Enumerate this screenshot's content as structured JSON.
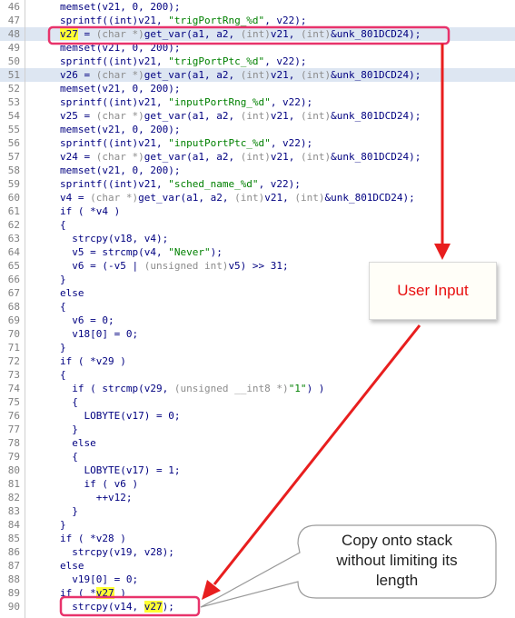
{
  "code_lines": [
    {
      "ln": "46",
      "parts": [
        {
          "t": "memset(v21, 0, 200);"
        }
      ]
    },
    {
      "ln": "47",
      "parts": [
        {
          "t": "sprintf((int)v21, "
        },
        {
          "t": "\"trigPortRng_%d\"",
          "c": "str"
        },
        {
          "t": ", v22);"
        }
      ]
    },
    {
      "ln": "48",
      "highlight": true,
      "parts": [
        {
          "t": "v27",
          "c": "yellow"
        },
        {
          "t": " = "
        },
        {
          "t": "(char *)",
          "c": "fade"
        },
        {
          "t": "get_var(a1, a2, "
        },
        {
          "t": "(int)",
          "c": "fade"
        },
        {
          "t": "v21, "
        },
        {
          "t": "(int)",
          "c": "fade"
        },
        {
          "t": "&unk_801DCD24);"
        }
      ]
    },
    {
      "ln": "49",
      "parts": [
        {
          "t": "memset(v21, 0, 200);"
        }
      ]
    },
    {
      "ln": "50",
      "parts": [
        {
          "t": "sprintf((int)v21, "
        },
        {
          "t": "\"trigPortPtc_%d\"",
          "c": "str"
        },
        {
          "t": ", v22);"
        }
      ]
    },
    {
      "ln": "51",
      "highlight": true,
      "parts": [
        {
          "t": "v26 = "
        },
        {
          "t": "(char *)",
          "c": "fade"
        },
        {
          "t": "get_var(a1, a2, "
        },
        {
          "t": "(int)",
          "c": "fade"
        },
        {
          "t": "v21, "
        },
        {
          "t": "(int)",
          "c": "fade"
        },
        {
          "t": "&unk_801DCD24);"
        }
      ]
    },
    {
      "ln": "52",
      "parts": [
        {
          "t": "memset(v21, 0, 200);"
        }
      ]
    },
    {
      "ln": "53",
      "parts": [
        {
          "t": "sprintf((int)v21, "
        },
        {
          "t": "\"inputPortRng_%d\"",
          "c": "str"
        },
        {
          "t": ", v22);"
        }
      ]
    },
    {
      "ln": "54",
      "parts": [
        {
          "t": "v25 = "
        },
        {
          "t": "(char *)",
          "c": "fade"
        },
        {
          "t": "get_var(a1, a2, "
        },
        {
          "t": "(int)",
          "c": "fade"
        },
        {
          "t": "v21, "
        },
        {
          "t": "(int)",
          "c": "fade"
        },
        {
          "t": "&unk_801DCD24);"
        }
      ]
    },
    {
      "ln": "55",
      "parts": [
        {
          "t": "memset(v21, 0, 200);"
        }
      ]
    },
    {
      "ln": "56",
      "parts": [
        {
          "t": "sprintf((int)v21, "
        },
        {
          "t": "\"inputPortPtc_%d\"",
          "c": "str"
        },
        {
          "t": ", v22);"
        }
      ]
    },
    {
      "ln": "57",
      "parts": [
        {
          "t": "v24 = "
        },
        {
          "t": "(char *)",
          "c": "fade"
        },
        {
          "t": "get_var(a1, a2, "
        },
        {
          "t": "(int)",
          "c": "fade"
        },
        {
          "t": "v21, "
        },
        {
          "t": "(int)",
          "c": "fade"
        },
        {
          "t": "&unk_801DCD24);"
        }
      ]
    },
    {
      "ln": "58",
      "parts": [
        {
          "t": "memset(v21, 0, 200);"
        }
      ]
    },
    {
      "ln": "59",
      "parts": [
        {
          "t": "sprintf((int)v21, "
        },
        {
          "t": "\"sched_name_%d\"",
          "c": "str"
        },
        {
          "t": ", v22);"
        }
      ]
    },
    {
      "ln": "60",
      "parts": [
        {
          "t": "v4 = "
        },
        {
          "t": "(char *)",
          "c": "fade"
        },
        {
          "t": "get_var(a1, a2, "
        },
        {
          "t": "(int)",
          "c": "fade"
        },
        {
          "t": "v21, "
        },
        {
          "t": "(int)",
          "c": "fade"
        },
        {
          "t": "&unk_801DCD24);"
        }
      ]
    },
    {
      "ln": "61",
      "parts": [
        {
          "t": "if ( *v4 )"
        }
      ]
    },
    {
      "ln": "62",
      "parts": [
        {
          "t": "{"
        }
      ]
    },
    {
      "ln": "63",
      "parts": [
        {
          "t": "  strcpy(v18, v4);"
        }
      ]
    },
    {
      "ln": "64",
      "parts": [
        {
          "t": "  v5 = strcmp(v4, "
        },
        {
          "t": "\"Never\"",
          "c": "str"
        },
        {
          "t": ");"
        }
      ]
    },
    {
      "ln": "65",
      "parts": [
        {
          "t": "  v6 = (-v5 | "
        },
        {
          "t": "(unsigned int)",
          "c": "fade"
        },
        {
          "t": "v5) >> 31;"
        }
      ]
    },
    {
      "ln": "66",
      "parts": [
        {
          "t": "}"
        }
      ]
    },
    {
      "ln": "67",
      "parts": [
        {
          "t": "else"
        }
      ]
    },
    {
      "ln": "68",
      "parts": [
        {
          "t": "{"
        }
      ]
    },
    {
      "ln": "69",
      "parts": [
        {
          "t": "  v6 = 0;"
        }
      ]
    },
    {
      "ln": "70",
      "parts": [
        {
          "t": "  v18[0] = 0;"
        }
      ]
    },
    {
      "ln": "71",
      "parts": [
        {
          "t": "}"
        }
      ]
    },
    {
      "ln": "72",
      "parts": [
        {
          "t": "if ( *v29 )"
        }
      ]
    },
    {
      "ln": "73",
      "parts": [
        {
          "t": "{"
        }
      ]
    },
    {
      "ln": "74",
      "parts": [
        {
          "t": "  if ( strcmp(v29, "
        },
        {
          "t": "(unsigned __int8 *)",
          "c": "fade"
        },
        {
          "t": "\"1\"",
          "c": "str"
        },
        {
          "t": ") )"
        }
      ]
    },
    {
      "ln": "75",
      "parts": [
        {
          "t": "  {"
        }
      ]
    },
    {
      "ln": "76",
      "parts": [
        {
          "t": "    LOBYTE(v17) = 0;"
        }
      ]
    },
    {
      "ln": "77",
      "parts": [
        {
          "t": "  }"
        }
      ]
    },
    {
      "ln": "78",
      "parts": [
        {
          "t": "  else"
        }
      ]
    },
    {
      "ln": "79",
      "parts": [
        {
          "t": "  {"
        }
      ]
    },
    {
      "ln": "80",
      "parts": [
        {
          "t": "    LOBYTE(v17) = 1;"
        }
      ]
    },
    {
      "ln": "81",
      "parts": [
        {
          "t": "    if ( v6 )"
        }
      ]
    },
    {
      "ln": "82",
      "parts": [
        {
          "t": "      ++v12;"
        }
      ]
    },
    {
      "ln": "83",
      "parts": [
        {
          "t": "  }"
        }
      ]
    },
    {
      "ln": "84",
      "parts": [
        {
          "t": "}"
        }
      ]
    },
    {
      "ln": "85",
      "parts": [
        {
          "t": "if ( *v28 )"
        }
      ]
    },
    {
      "ln": "86",
      "parts": [
        {
          "t": "  strcpy(v19, v28);"
        }
      ]
    },
    {
      "ln": "87",
      "parts": [
        {
          "t": "else"
        }
      ]
    },
    {
      "ln": "88",
      "parts": [
        {
          "t": "  v19[0] = 0;"
        }
      ]
    },
    {
      "ln": "89",
      "parts": [
        {
          "t": "if ( *"
        },
        {
          "t": "v27",
          "c": "yellow"
        },
        {
          "t": " )"
        }
      ]
    },
    {
      "ln": "90",
      "parts": [
        {
          "t": "  strcpy(v14, "
        },
        {
          "t": "v27",
          "c": "yellow"
        },
        {
          "t": ");"
        }
      ]
    }
  ],
  "annotations": {
    "user_input_label": "User Input",
    "callout_line1": "Copy onto stack",
    "callout_line2": "without limiting its",
    "callout_line3": "length"
  },
  "colors": {
    "highlight_box": "#e8336b",
    "arrow": "#e81e1e",
    "code_text": "#000080",
    "string_text": "#008000",
    "yellow_highlight": "#ffff33"
  }
}
